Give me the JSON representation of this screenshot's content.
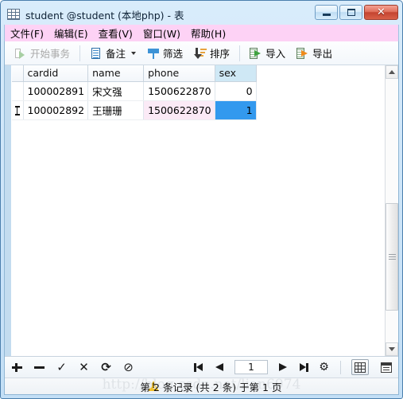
{
  "window": {
    "title": "student @student (本地php) - 表",
    "icon": "table-icon",
    "buttons": {
      "minimize": "−",
      "maximize": "▫",
      "close": "✕"
    }
  },
  "menubar": {
    "items": [
      {
        "label": "文件(F)"
      },
      {
        "label": "编辑(E)"
      },
      {
        "label": "查看(V)"
      },
      {
        "label": "窗口(W)"
      },
      {
        "label": "帮助(H)"
      }
    ]
  },
  "toolbar": {
    "begin_transaction": "开始事务",
    "note": "备注",
    "filter": "筛选",
    "sort": "排序",
    "import": "导入",
    "export": "导出"
  },
  "grid": {
    "columns": [
      {
        "key": "cardid",
        "label": "cardid",
        "active": false
      },
      {
        "key": "name",
        "label": "name",
        "active": false
      },
      {
        "key": "phone",
        "label": "phone",
        "active": false
      },
      {
        "key": "sex",
        "label": "sex",
        "active": true
      }
    ],
    "rows": [
      {
        "marker": "",
        "cardid": "100002891",
        "name": "宋文强",
        "phone": "1500622870",
        "sex": "0"
      },
      {
        "marker": "ibeam-cursor",
        "cardid": "100002892",
        "name": "王珊珊",
        "phone": "1500622870",
        "sex": "1"
      }
    ],
    "selection_color": "#3399ee",
    "modified_color": "#fbeaf6",
    "active_header_color": "#cfe8f5"
  },
  "navbar": {
    "record_buttons": [
      {
        "name": "add-record-button",
        "glyph": "+"
      },
      {
        "name": "delete-record-button",
        "glyph": "−"
      },
      {
        "name": "apply-changes-button",
        "glyph": "✓"
      },
      {
        "name": "cancel-changes-button",
        "glyph": "✕"
      },
      {
        "name": "refresh-button",
        "glyph": "⟳"
      },
      {
        "name": "stop-button",
        "glyph": "⊘"
      }
    ],
    "page_value": "1",
    "nav_buttons": [
      {
        "name": "first-page-button",
        "glyph": "⏮"
      },
      {
        "name": "previous-page-button",
        "glyph": "◀"
      },
      {
        "name": "next-page-button",
        "glyph": "▶"
      },
      {
        "name": "last-page-button",
        "glyph": "⏭"
      },
      {
        "name": "settings-button",
        "glyph": "⚙"
      }
    ],
    "view_grid": "grid-view",
    "view_form": "form-view"
  },
  "statusbar": {
    "text": "第 2 条记录 (共 2 条) 于第 1 页",
    "warning_icon": "warning-triangle-icon",
    "watermark": "http://blog.csdn.net/lian6974"
  }
}
